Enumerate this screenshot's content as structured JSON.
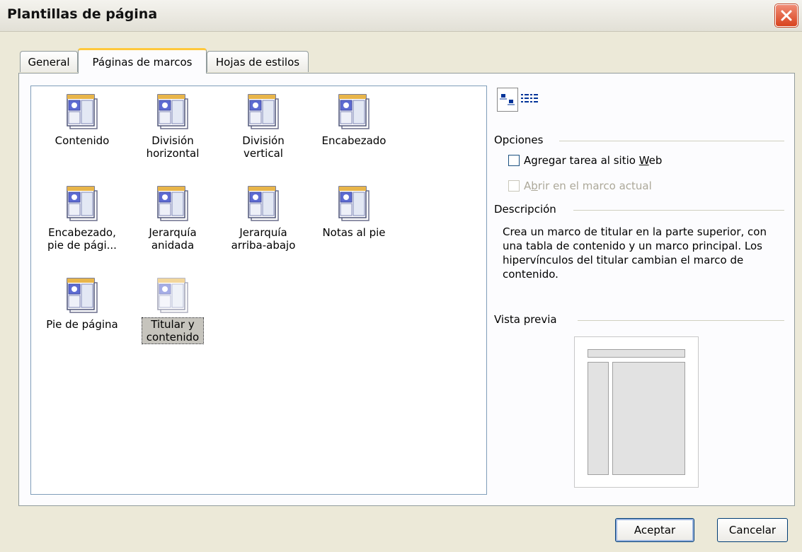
{
  "window": {
    "title": "Plantillas de página"
  },
  "tabs": [
    {
      "label": "General"
    },
    {
      "label": "Páginas de marcos"
    },
    {
      "label": "Hojas de estilos"
    }
  ],
  "templates": [
    {
      "label": "Contenido"
    },
    {
      "label": "División horizontal"
    },
    {
      "label": "División vertical"
    },
    {
      "label": "Encabezado"
    },
    {
      "label": "Encabezado, pie de pági..."
    },
    {
      "label": "Jerarquía anidada"
    },
    {
      "label": "Jerarquía arriba-abajo"
    },
    {
      "label": "Notas al pie"
    },
    {
      "label": "Pie de página"
    },
    {
      "label": "Titular y contenido",
      "selected": true
    }
  ],
  "view_buttons": {
    "large_icons": "large-icons-view-icon",
    "details": "details-view-icon"
  },
  "options": {
    "heading": "Opciones",
    "add_task_prefix": "Agregar tarea al sitio ",
    "add_task_accel": "W",
    "add_task_suffix": "eb",
    "open_prefix": "A",
    "open_accel": "b",
    "open_suffix": "rir en el marco actual"
  },
  "description": {
    "heading": "Descripción",
    "text": "Crea un marco de titular en la parte superior, con una tabla de contenido y un marco principal.  Los hipervínculos del titular cambian el marco de contenido."
  },
  "preview": {
    "heading": "Vista previa"
  },
  "buttons": {
    "ok": "Aceptar",
    "cancel": "Cancelar"
  },
  "colors": {
    "accent_tab": "#ffc83c",
    "close": "#d8431e",
    "dialog_bg": "#ece9d8"
  }
}
